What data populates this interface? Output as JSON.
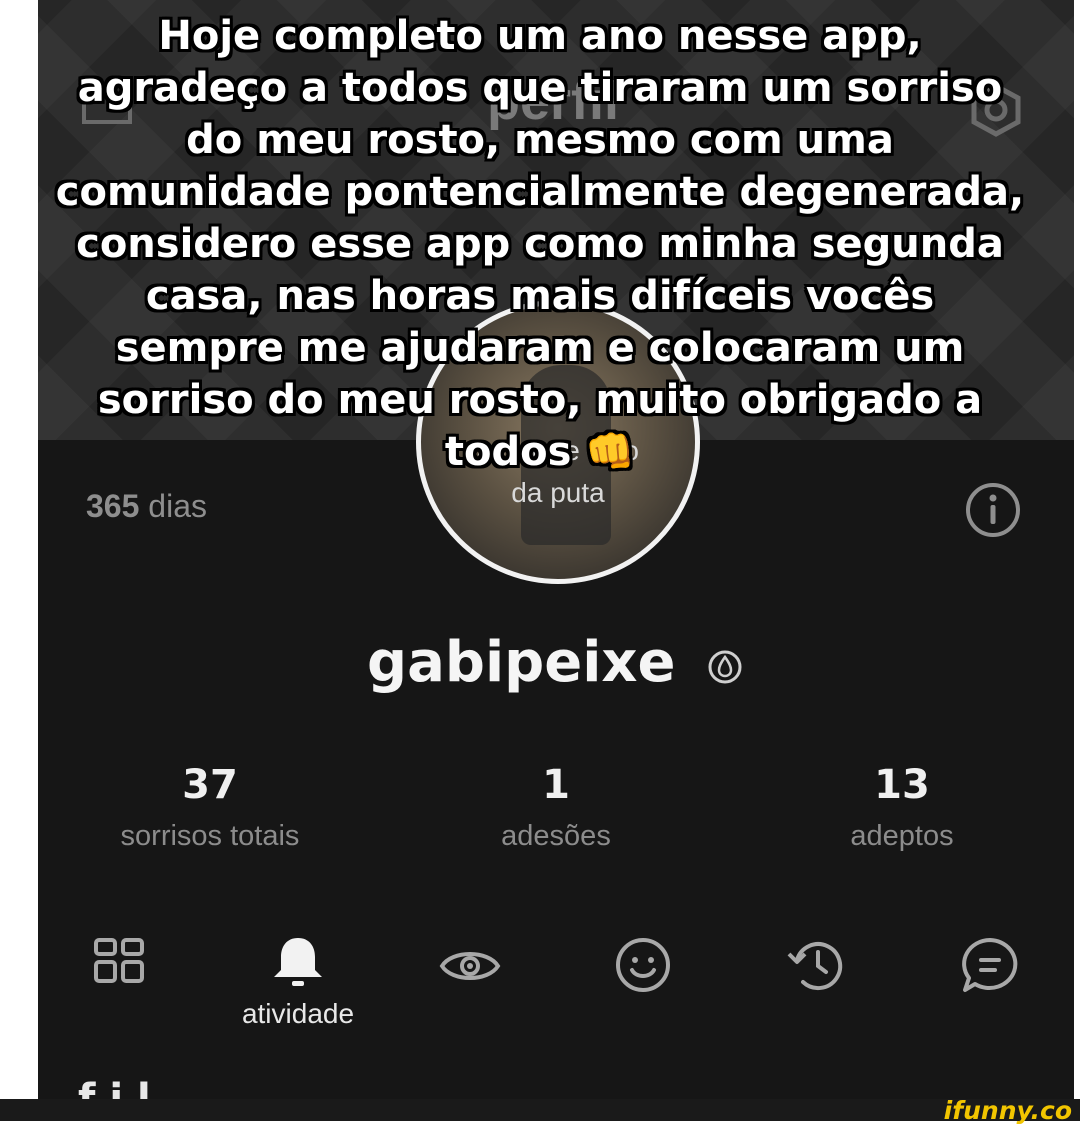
{
  "header": {
    "title": "perfil"
  },
  "profile": {
    "avatar_text_line1": "a dor de filho",
    "avatar_text_line2": "da puta",
    "days_number": "365",
    "days_label": "dias",
    "username": "gabipeixe",
    "verified_icon": "droplet-icon"
  },
  "stats": [
    {
      "value": "37",
      "label": "sorrisos totais"
    },
    {
      "value": "1",
      "label": "adesões"
    },
    {
      "value": "13",
      "label": "adeptos"
    }
  ],
  "tabs": {
    "icons": [
      "grid-icon",
      "bell-icon",
      "eye-icon",
      "smiley-icon",
      "history-icon",
      "chat-icon"
    ],
    "active_label": "atividade"
  },
  "cut_text": "f          i  l",
  "caption": {
    "lines": [
      "Hoje completo um ano nesse app,",
      "agradeço a todos que tiraram um sorriso",
      "do meu rosto, mesmo com uma",
      "comunidade pontencialmente degenerada,",
      "considero esse app como minha segunda",
      "casa, nas horas mais difíceis vocês",
      "sempre me ajudaram e colocaram um",
      "sorriso do meu rosto, muito obrigado a",
      "todos 👊"
    ]
  },
  "watermark": "ifunny.co",
  "colors": {
    "background": "#161616",
    "header": "#262626",
    "watermark": "#f2c500"
  }
}
